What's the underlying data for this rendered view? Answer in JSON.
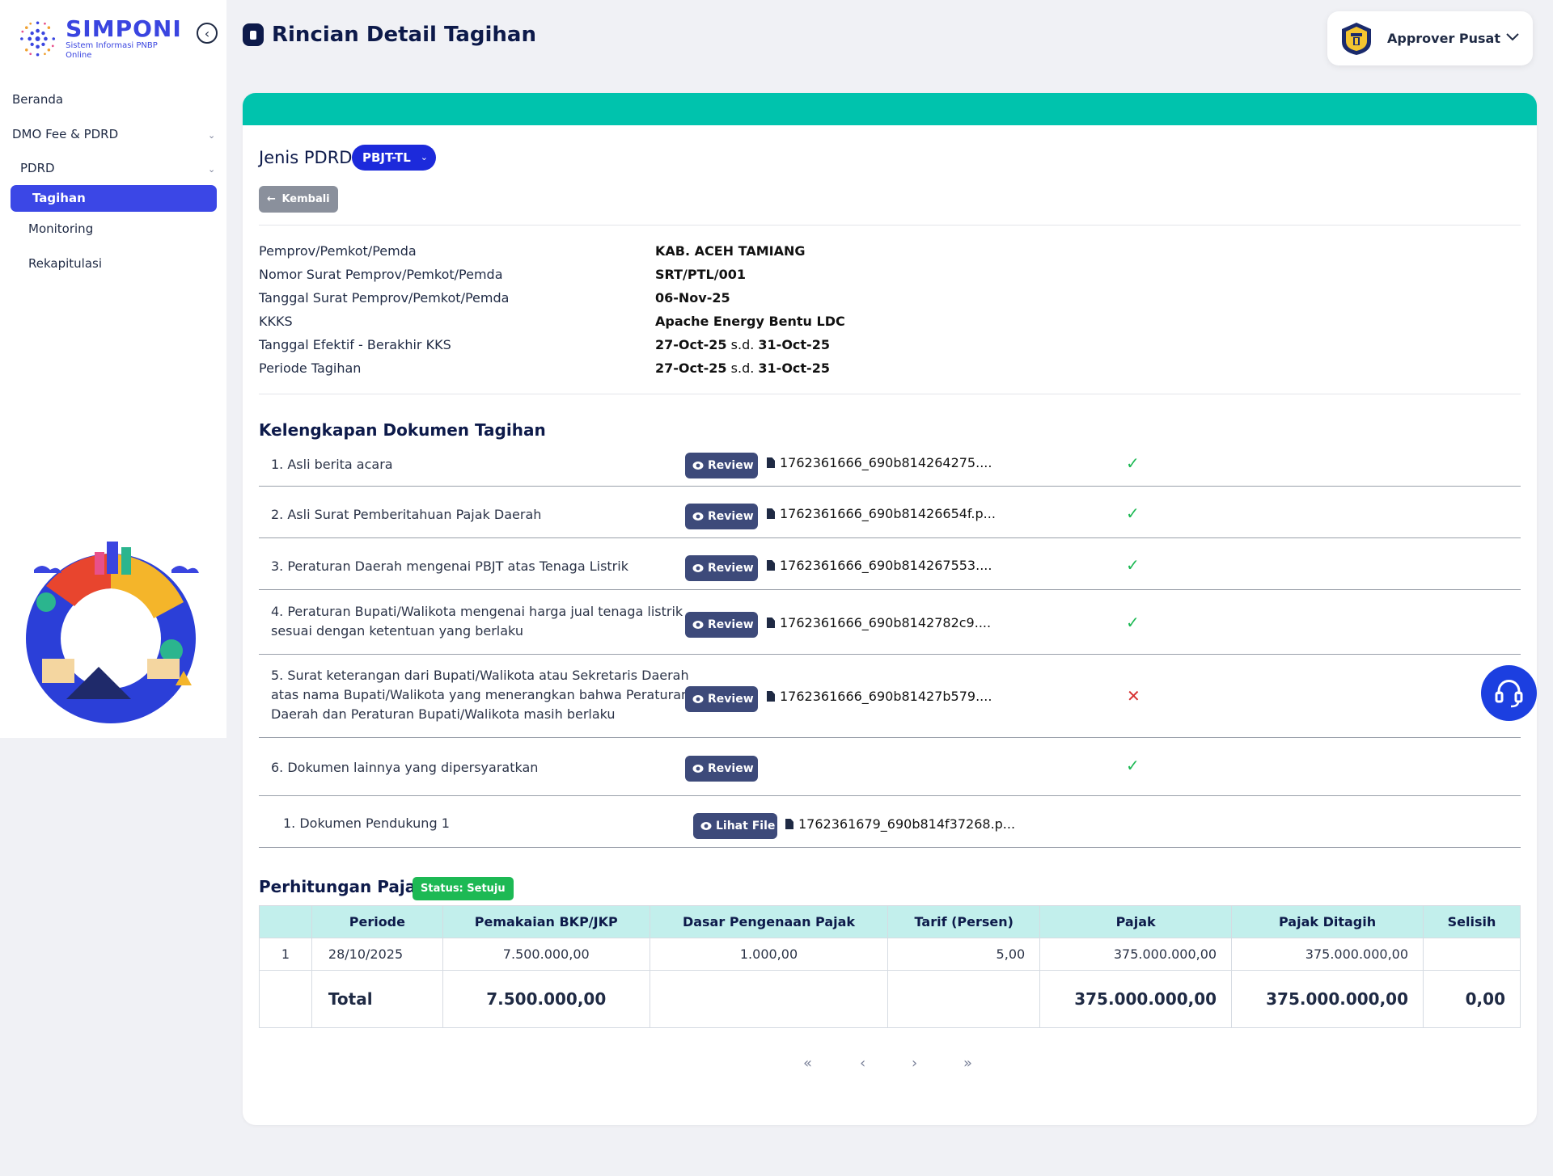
{
  "app": {
    "logo_title": "SIMPONI",
    "logo_subtitle": "Sistem Informasi PNBP Online"
  },
  "sidebar": {
    "items": [
      {
        "label": "Beranda"
      },
      {
        "label": "DMO Fee & PDRD"
      },
      {
        "label": "PDRD"
      },
      {
        "label": "Tagihan"
      },
      {
        "label": "Monitoring"
      },
      {
        "label": "Rekapitulasi"
      }
    ]
  },
  "header": {
    "title": "Rincian Detail Tagihan",
    "user": "Approver Pusat"
  },
  "form": {
    "jenis_label": "Jenis PDRD",
    "jenis_value": "PBJT-TL",
    "back_label": "Kembali"
  },
  "info": [
    {
      "label": "Pemprov/Pemkot/Pemda",
      "value": "KAB. ACEH TAMIANG"
    },
    {
      "label": "Nomor Surat Pemprov/Pemkot/Pemda",
      "value": "SRT/PTL/001"
    },
    {
      "label": "Tanggal Surat Pemprov/Pemkot/Pemda",
      "value": "06-Nov-25"
    },
    {
      "label": "KKKS",
      "value": "Apache Energy Bentu LDC"
    },
    {
      "label": "Tanggal Efektif - Berakhir KKS",
      "from": "27-Oct-25",
      "sep": "s.d.",
      "to": "31-Oct-25"
    },
    {
      "label": "Periode Tagihan",
      "from": "27-Oct-25",
      "sep": "s.d.",
      "to": "31-Oct-25"
    }
  ],
  "documents": {
    "title": "Kelengkapan Dokumen Tagihan",
    "review_label": "Review",
    "view_file_label": "Lihat File",
    "items": [
      {
        "text": "1. Asli berita acara",
        "file": "1762361666_690b814264275....",
        "status": "ok"
      },
      {
        "text": "2. Asli Surat Pemberitahuan Pajak Daerah",
        "file": "1762361666_690b81426654f.p...",
        "status": "ok"
      },
      {
        "text": "3. Peraturan Daerah mengenai PBJT atas Tenaga Listrik",
        "file": "1762361666_690b814267553....",
        "status": "ok"
      },
      {
        "text_lines": [
          "4. Peraturan Bupati/Walikota mengenai harga jual tenaga listrik",
          "sesuai dengan ketentuan yang berlaku"
        ],
        "file": "1762361666_690b8142782c9....",
        "status": "ok"
      },
      {
        "text_lines": [
          "5. Surat keterangan dari Bupati/Walikota atau Sekretaris Daerah",
          "atas nama Bupati/Walikota yang menerangkan bahwa Peraturan",
          "Daerah dan Peraturan Bupati/Walikota masih berlaku"
        ],
        "file": "1762361666_690b81427b579....",
        "status": "fail"
      },
      {
        "text": "6. Dokumen lainnya yang dipersyaratkan",
        "file": "",
        "status": "ok"
      }
    ],
    "supporting": {
      "text": "1. Dokumen Pendukung 1",
      "file": "1762361679_690b814f37268.p..."
    }
  },
  "tax": {
    "title": "Perhitungan Pajak",
    "status_badge": "Status: Setuju",
    "columns": [
      "",
      "Periode",
      "Pemakaian BKP/JKP",
      "Dasar Pengenaan Pajak",
      "Tarif (Persen)",
      "Pajak",
      "Pajak Ditagih",
      "Selisih"
    ],
    "rows": [
      [
        "1",
        "28/10/2025",
        "7.500.000,00",
        "1.000,00",
        "5,00",
        "375.000.000,00",
        "375.000.000,00",
        ""
      ]
    ],
    "total": {
      "label": "Total",
      "pemakaian": "7.500.000,00",
      "dasar": "",
      "tarif": "",
      "pajak": "375.000.000,00",
      "ditagih": "375.000.000,00",
      "selisih": "0,00"
    }
  },
  "pager": {
    "first": "«",
    "prev": "‹",
    "next": "›",
    "last": "»"
  },
  "colors": {
    "accent": "#3b47e6",
    "teal": "#00c3ad",
    "ok": "#1db954",
    "fail": "#d63030"
  }
}
